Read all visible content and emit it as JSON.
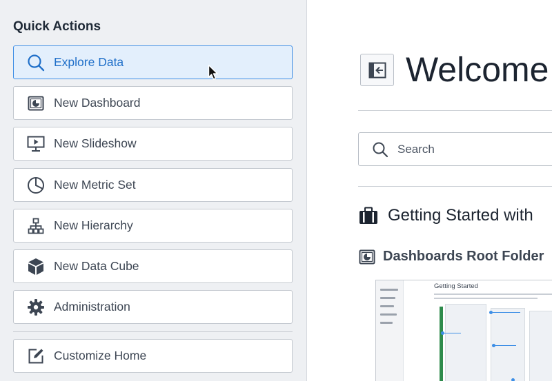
{
  "sidebar": {
    "title": "Quick Actions",
    "actions": [
      {
        "label": "Explore Data",
        "icon": "search-icon",
        "active": true
      },
      {
        "label": "New Dashboard",
        "icon": "dashboard-icon"
      },
      {
        "label": "New Slideshow",
        "icon": "slideshow-icon"
      },
      {
        "label": "New Metric Set",
        "icon": "pie-chart-icon"
      },
      {
        "label": "New Hierarchy",
        "icon": "hierarchy-icon"
      },
      {
        "label": "New Data Cube",
        "icon": "cube-icon"
      },
      {
        "label": "Administration",
        "icon": "gear-icon"
      }
    ],
    "customize": {
      "label": "Customize Home",
      "icon": "edit-icon"
    }
  },
  "main": {
    "title": "Welcome",
    "search_placeholder": "Search",
    "getting_started": "Getting Started with",
    "dashboards_root": "Dashboards Root Folder",
    "thumbnail_title": "Getting Started"
  },
  "colors": {
    "accent": "#1f6fc9",
    "active_bg": "#e3effc",
    "sidebar_bg": "#eef0f3"
  }
}
